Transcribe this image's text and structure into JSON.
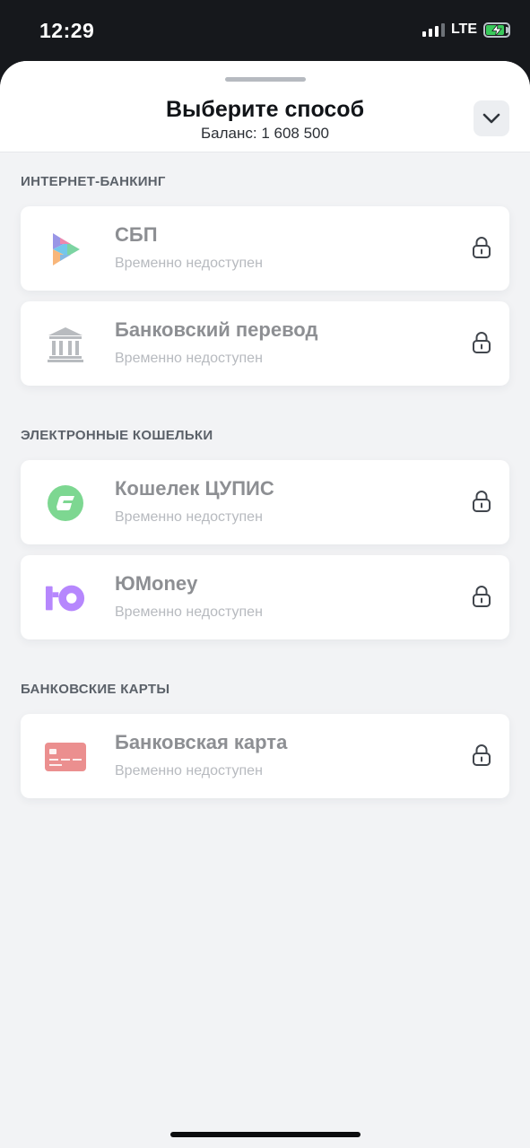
{
  "status_bar": {
    "time": "12:29",
    "network": "LTE",
    "battery_level": 0.85,
    "charging": true
  },
  "sheet": {
    "title": "Выберите способ",
    "balance": "Баланс: 1 608 500"
  },
  "sections": [
    {
      "title": "ИНТЕРНЕТ-БАНКИНГ",
      "methods": [
        {
          "name": "СБП",
          "status": "Временно недоступен",
          "icon": "sbp-icon",
          "locked": true
        },
        {
          "name": "Банковский перевод",
          "status": "Временно недоступен",
          "icon": "bank-icon",
          "locked": true
        }
      ]
    },
    {
      "title": "ЭЛЕКТРОННЫЕ КОШЕЛЬКИ",
      "methods": [
        {
          "name": "Кошелек ЦУПИС",
          "status": "Временно недоступен",
          "icon": "cupis-wallet-icon",
          "locked": true
        },
        {
          "name": "ЮMoney",
          "status": "Временно недоступен",
          "icon": "yumoney-icon",
          "locked": true
        }
      ]
    },
    {
      "title": "БАНКОВСКИЕ КАРТЫ",
      "methods": [
        {
          "name": "Банковская карта",
          "status": "Временно недоступен",
          "icon": "bank-card-icon",
          "locked": true
        }
      ]
    }
  ],
  "colors": {
    "sheet_background": "#f2f3f5",
    "card_background": "#ffffff",
    "status_bar_background": "#16181c",
    "cupis_green": "#2fbf4f",
    "yumoney_purple": "#8b3ffd",
    "card_red": "#e04b4b"
  }
}
